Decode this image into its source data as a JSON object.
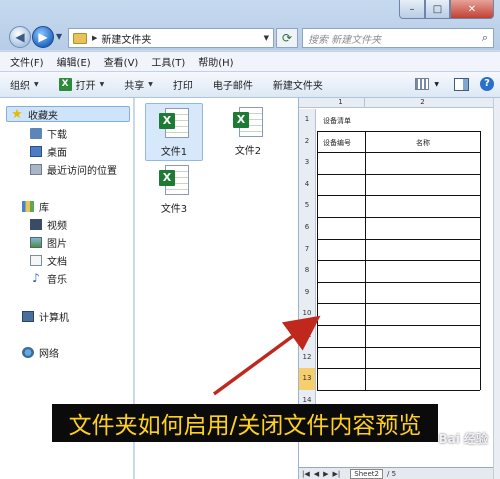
{
  "window": {
    "address_path": "新建文件夹",
    "search_placeholder": "搜索 新建文件夹",
    "minimize": "–",
    "maximize": "□",
    "close": "✕"
  },
  "menubar": [
    "文件(F)",
    "编辑(E)",
    "查看(V)",
    "工具(T)",
    "帮助(H)"
  ],
  "toolbar": {
    "organize": "组织",
    "open": "打开",
    "share": "共享",
    "print": "打印",
    "email": "电子邮件",
    "new_folder": "新建文件夹"
  },
  "nav": {
    "favorites": "收藏夹",
    "downloads": "下载",
    "desktop": "桌面",
    "recent": "最近访问的位置",
    "libraries": "库",
    "videos": "视频",
    "pictures": "图片",
    "documents": "文档",
    "music": "音乐",
    "computer": "计算机",
    "network": "网络"
  },
  "files": [
    "文件1",
    "文件2",
    "文件3"
  ],
  "preview": {
    "col_headers": [
      "1",
      "2"
    ],
    "row_headers": [
      "1",
      "2",
      "3",
      "4",
      "5",
      "6",
      "7",
      "8",
      "9",
      "10",
      "11",
      "12",
      "13",
      "14"
    ],
    "title_cell": "设备清单",
    "header_col1": "设备编号",
    "header_col2": "名称",
    "sheet_tab": "Sheet2",
    "sheet_tab_extra": "/ 5"
  },
  "caption": "文件夹如何启用/关闭文件内容预览",
  "watermark": "Bai 经验",
  "colors": {
    "caption_bg": "#0b0b0b",
    "caption_text": "#ffd11f",
    "arrow": "#c0281e",
    "selection": "#cde4fb"
  }
}
